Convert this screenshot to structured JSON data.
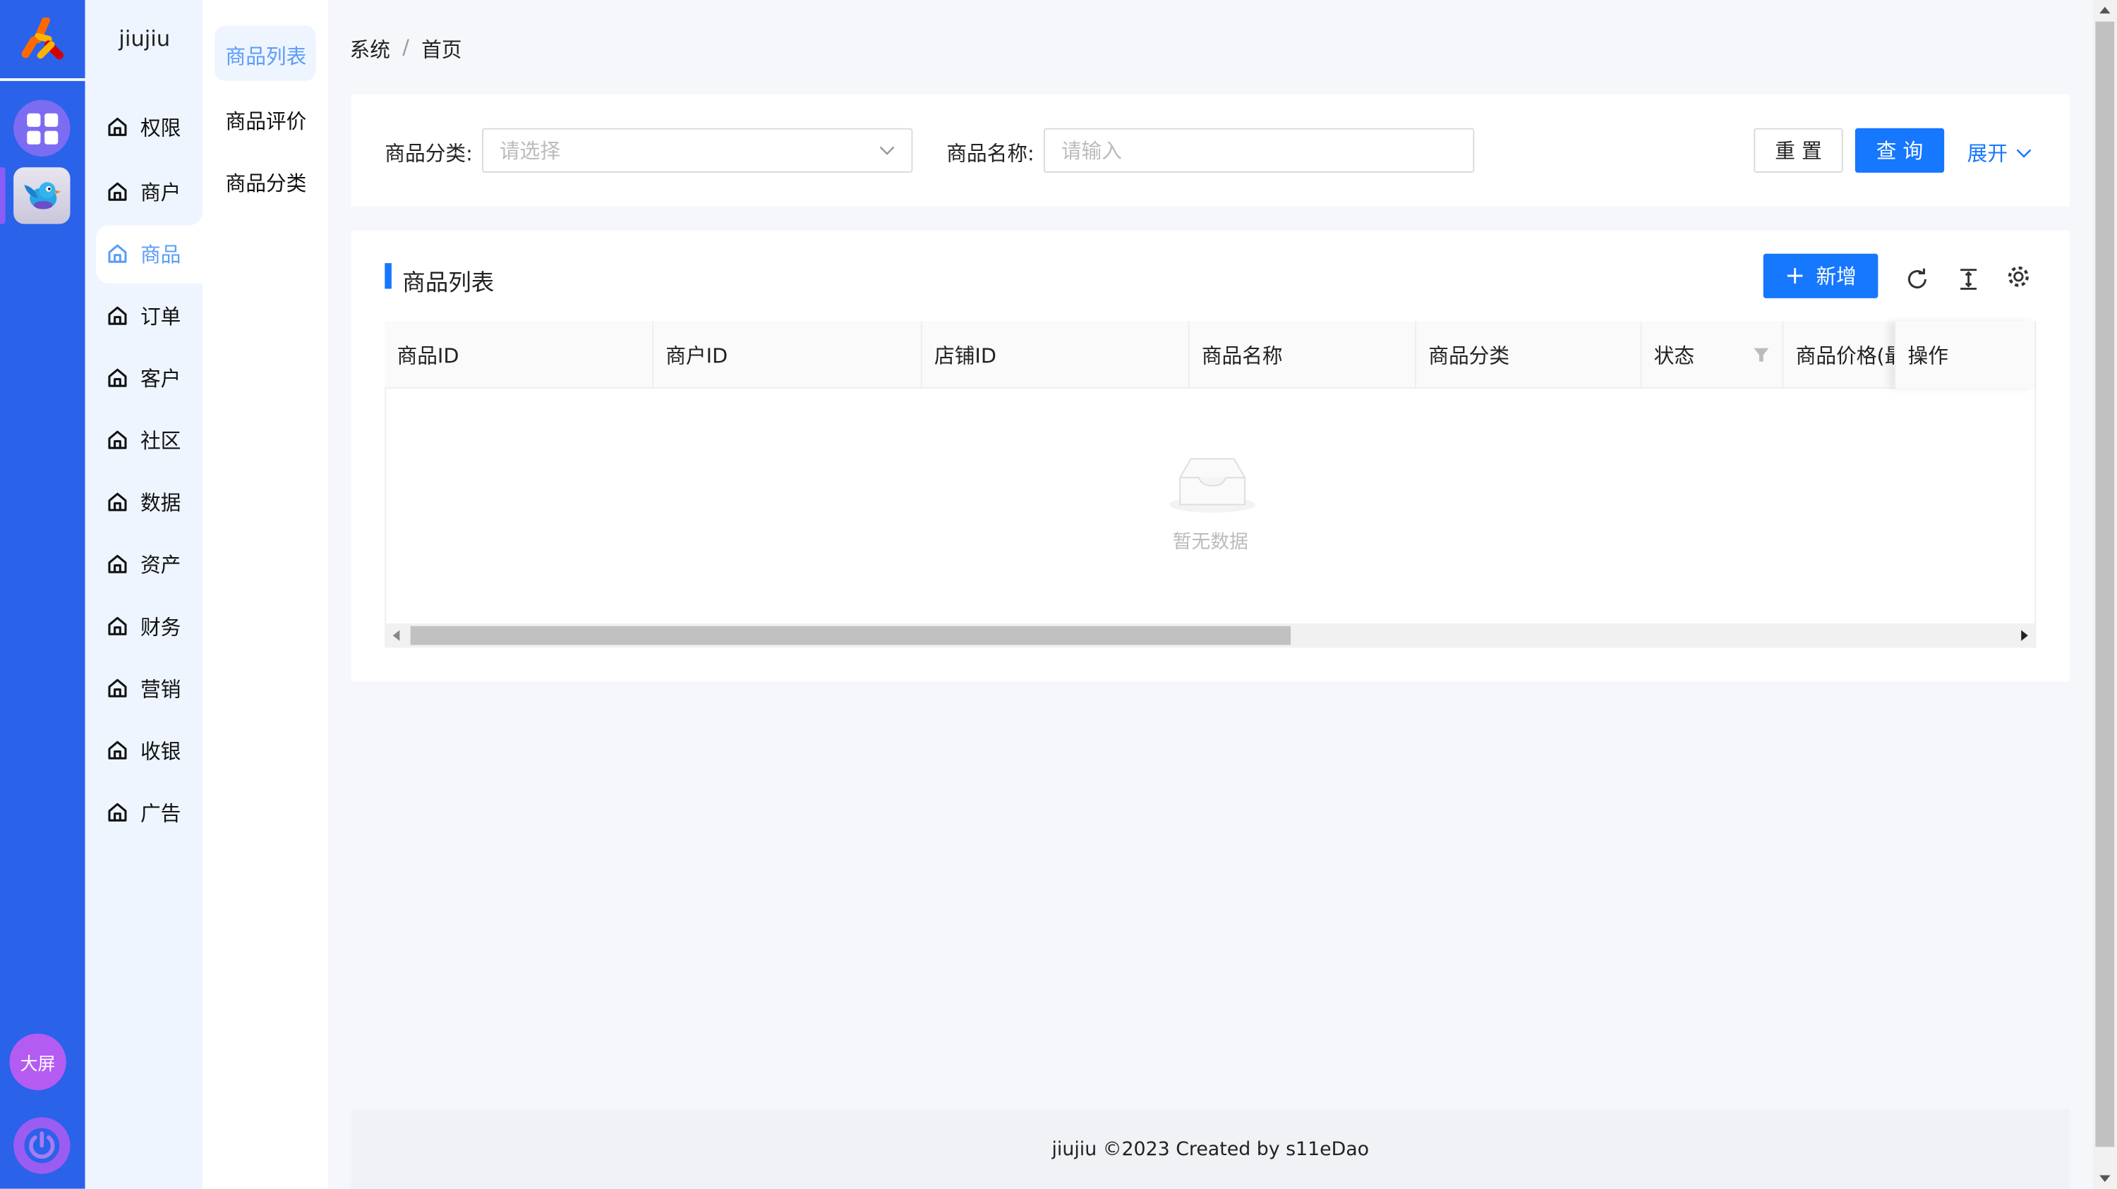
{
  "app": {
    "name": "jiujiu",
    "big_screen_label": "大屏"
  },
  "nav": {
    "items": [
      {
        "label": "权限"
      },
      {
        "label": "商户"
      },
      {
        "label": "商品"
      },
      {
        "label": "订单"
      },
      {
        "label": "客户"
      },
      {
        "label": "社区"
      },
      {
        "label": "数据"
      },
      {
        "label": "资产"
      },
      {
        "label": "财务"
      },
      {
        "label": "营销"
      },
      {
        "label": "收银"
      },
      {
        "label": "广告"
      }
    ],
    "active": "商品"
  },
  "subnav": {
    "items": [
      {
        "label": "商品列表"
      },
      {
        "label": "商品评价"
      },
      {
        "label": "商品分类"
      }
    ],
    "active": "商品列表"
  },
  "breadcrumb": [
    "系统",
    "首页"
  ],
  "search": {
    "category_label": "商品分类:",
    "category_placeholder": "请选择",
    "name_label": "商品名称:",
    "name_placeholder": "请输入",
    "reset": "重 置",
    "query": "查 询",
    "expand": "展开"
  },
  "table": {
    "title": "商品列表",
    "add": "新增",
    "columns": [
      "商品ID",
      "商户ID",
      "店铺ID",
      "商品名称",
      "商品分类",
      "状态",
      "商品价格(最",
      "操作"
    ],
    "empty": "暂无数据",
    "scroll_fraction": 0.55
  },
  "footer": "jiujiu ©2023 Created by s11eDao",
  "colors": {
    "rail": "#2a62ea",
    "primary": "#1677ff",
    "active_text": "#5b9cf8"
  }
}
